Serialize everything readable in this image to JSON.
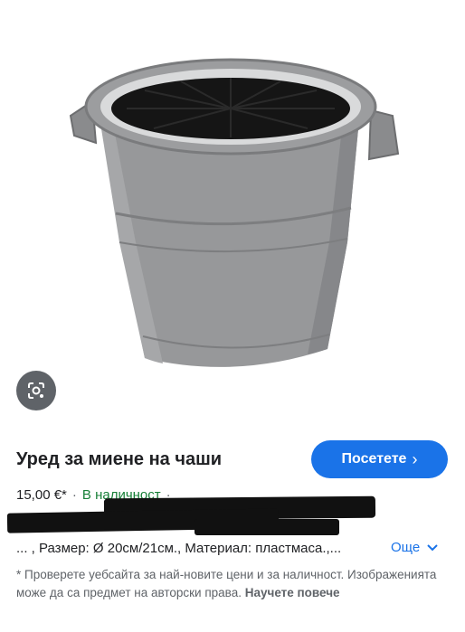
{
  "product": {
    "title": "Уред за миене на чаши",
    "price": "15,00 €*",
    "separator": "·",
    "stock": "В наличност",
    "description": "... , Размер: Ø 20см/21см., Материал: пластмаса.,..."
  },
  "actions": {
    "visit_label": "Посетете",
    "visit_chevron": "›",
    "more_label": "Още"
  },
  "disclaimer": {
    "text": "* Проверете уебсайта за най-новите цени и за наличност. Изображенията може да са предмет на авторски права.",
    "learn_more": "Научете повече"
  },
  "icons": {
    "lens": "lens-icon",
    "more_chevron": "chevron-down-icon"
  },
  "colors": {
    "accent": "#1a73e8",
    "stock_green": "#188038",
    "lens_button": "#5f6368"
  }
}
